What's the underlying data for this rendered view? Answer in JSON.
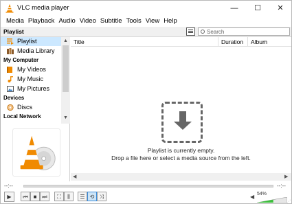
{
  "window": {
    "title": "VLC media player"
  },
  "titlebar": {
    "minimize": "—",
    "maximize": "☐",
    "close": "✕"
  },
  "menu": [
    "Media",
    "Playback",
    "Audio",
    "Video",
    "Subtitle",
    "Tools",
    "View",
    "Help"
  ],
  "playlist_header": {
    "label": "Playlist",
    "search_placeholder": "Search"
  },
  "sidebar": {
    "sections": {
      "my_computer": "My Computer",
      "devices": "Devices",
      "local_network": "Local Network"
    },
    "items": {
      "playlist": "Playlist",
      "media_library": "Media Library",
      "my_videos": "My Videos",
      "my_music": "My Music",
      "my_pictures": "My Pictures",
      "discs": "Discs"
    }
  },
  "columns": [
    "Title",
    "Duration",
    "Album"
  ],
  "empty_state": {
    "line1": "Playlist is currently empty.",
    "line2": "Drop a file here or select a media source from the left."
  },
  "seek": {
    "elapsed": "--:--",
    "total": "--:--"
  },
  "volume": {
    "percent_label": "54%",
    "level": 0.54
  },
  "colors": {
    "selection": "#cce8ff",
    "accent_orange": "#f08a00",
    "volume_green": "#3cbf3c"
  }
}
